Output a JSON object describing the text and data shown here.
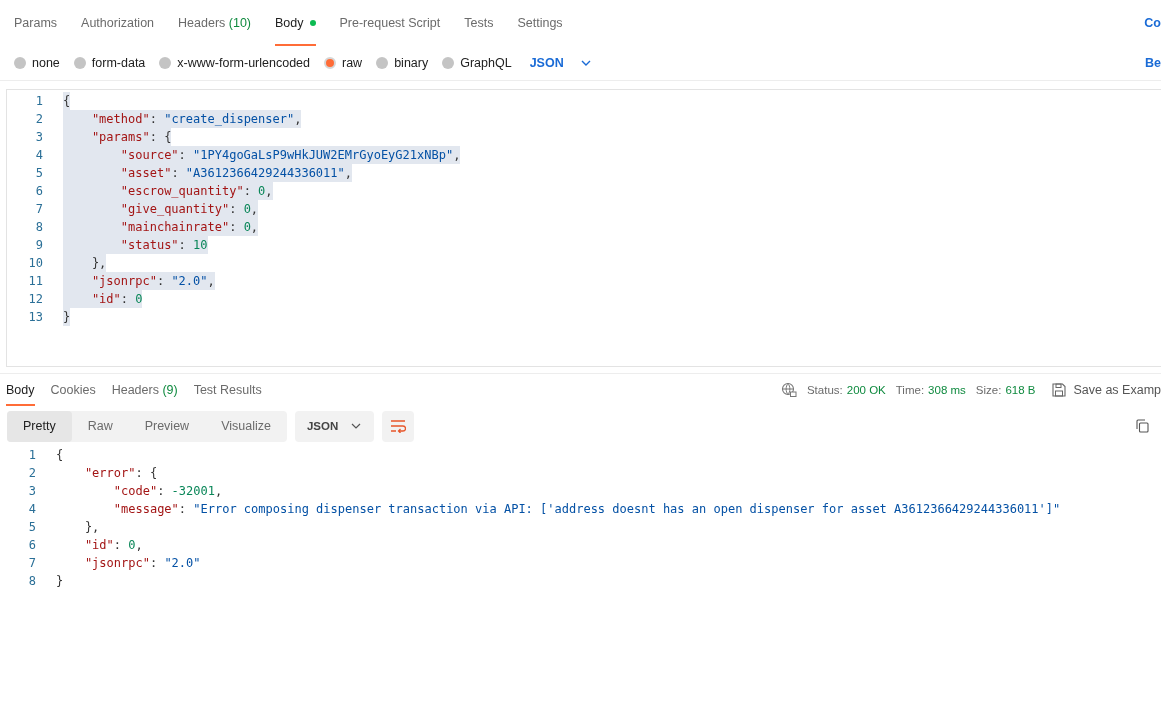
{
  "request_tabs": [
    {
      "label": "Params",
      "selected": false
    },
    {
      "label": "Authorization",
      "selected": false
    },
    {
      "label": "Headers",
      "count": "(10)",
      "selected": false
    },
    {
      "label": "Body",
      "dot": true,
      "selected": true
    },
    {
      "label": "Pre-request Script",
      "selected": false
    },
    {
      "label": "Tests",
      "selected": false
    },
    {
      "label": "Settings",
      "selected": false
    }
  ],
  "request_tabs_right_link": "Co",
  "body_types": [
    {
      "label": "none",
      "selected": false
    },
    {
      "label": "form-data",
      "selected": false
    },
    {
      "label": "x-www-form-urlencoded",
      "selected": false
    },
    {
      "label": "raw",
      "selected": true
    },
    {
      "label": "binary",
      "selected": false
    },
    {
      "label": "GraphQL",
      "selected": false
    }
  ],
  "body_format": "JSON",
  "beautify_link": "Be",
  "request_body": [
    {
      "number": "1",
      "selected": true,
      "tokens": [
        {
          "kind": "punct",
          "text": "{"
        }
      ]
    },
    {
      "number": "2",
      "selected": true,
      "tokens": [
        {
          "kind": "key",
          "text": "    \"method\""
        },
        {
          "kind": "punct",
          "text": ": "
        },
        {
          "kind": "str",
          "text": "\"create_dispenser\""
        },
        {
          "kind": "punct",
          "text": ","
        }
      ]
    },
    {
      "number": "3",
      "selected": true,
      "tokens": [
        {
          "kind": "key",
          "text": "    \"params\""
        },
        {
          "kind": "punct",
          "text": ": {"
        }
      ]
    },
    {
      "number": "4",
      "selected": true,
      "tokens": [
        {
          "kind": "key",
          "text": "        \"source\""
        },
        {
          "kind": "punct",
          "text": ": "
        },
        {
          "kind": "str",
          "text": "\"1PY4goGaLsP9wHkJUW2EMrGyoEyG21xNBp\""
        },
        {
          "kind": "punct",
          "text": ","
        }
      ]
    },
    {
      "number": "5",
      "selected": true,
      "tokens": [
        {
          "kind": "key",
          "text": "        \"asset\""
        },
        {
          "kind": "punct",
          "text": ": "
        },
        {
          "kind": "str",
          "text": "\"A3612366429244336011\""
        },
        {
          "kind": "punct",
          "text": ","
        }
      ]
    },
    {
      "number": "6",
      "selected": true,
      "tokens": [
        {
          "kind": "key",
          "text": "        \"escrow_quantity\""
        },
        {
          "kind": "punct",
          "text": ": "
        },
        {
          "kind": "num",
          "text": "0"
        },
        {
          "kind": "punct",
          "text": ","
        }
      ]
    },
    {
      "number": "7",
      "selected": true,
      "tokens": [
        {
          "kind": "key",
          "text": "        \"give_quantity\""
        },
        {
          "kind": "punct",
          "text": ": "
        },
        {
          "kind": "num",
          "text": "0"
        },
        {
          "kind": "punct",
          "text": ","
        }
      ]
    },
    {
      "number": "8",
      "selected": true,
      "tokens": [
        {
          "kind": "key",
          "text": "        \"mainchainrate\""
        },
        {
          "kind": "punct",
          "text": ": "
        },
        {
          "kind": "num",
          "text": "0"
        },
        {
          "kind": "punct",
          "text": ","
        }
      ]
    },
    {
      "number": "9",
      "selected": true,
      "tokens": [
        {
          "kind": "key",
          "text": "        \"status\""
        },
        {
          "kind": "punct",
          "text": ": "
        },
        {
          "kind": "num",
          "text": "10"
        }
      ]
    },
    {
      "number": "10",
      "selected": true,
      "tokens": [
        {
          "kind": "punct",
          "text": "    },"
        }
      ]
    },
    {
      "number": "11",
      "selected": true,
      "tokens": [
        {
          "kind": "key",
          "text": "    \"jsonrpc\""
        },
        {
          "kind": "punct",
          "text": ": "
        },
        {
          "kind": "str",
          "text": "\"2.0\""
        },
        {
          "kind": "punct",
          "text": ","
        }
      ]
    },
    {
      "number": "12",
      "selected": true,
      "tokens": [
        {
          "kind": "key",
          "text": "    \"id\""
        },
        {
          "kind": "punct",
          "text": ": "
        },
        {
          "kind": "num",
          "text": "0"
        }
      ]
    },
    {
      "number": "13",
      "selected": true,
      "tokens": [
        {
          "kind": "punct",
          "text": "}"
        }
      ]
    }
  ],
  "response_tabs": [
    {
      "label": "Body",
      "selected": true
    },
    {
      "label": "Cookies",
      "selected": false
    },
    {
      "label": "Headers",
      "count": "(9)",
      "selected": false
    },
    {
      "label": "Test Results",
      "selected": false
    }
  ],
  "status": {
    "status_label": "Status:",
    "status_value": "200 OK",
    "time_label": "Time:",
    "time_value": "308 ms",
    "size_label": "Size:",
    "size_value": "618 B",
    "save_label": "Save as Examp"
  },
  "view_modes": [
    {
      "label": "Pretty",
      "selected": true
    },
    {
      "label": "Raw",
      "selected": false
    },
    {
      "label": "Preview",
      "selected": false
    },
    {
      "label": "Visualize",
      "selected": false
    }
  ],
  "response_format": "JSON",
  "response_body": [
    {
      "number": "1",
      "tokens": [
        {
          "kind": "punct",
          "text": "{"
        }
      ]
    },
    {
      "number": "2",
      "tokens": [
        {
          "kind": "key",
          "text": "    \"error\""
        },
        {
          "kind": "punct",
          "text": ": {"
        }
      ]
    },
    {
      "number": "3",
      "tokens": [
        {
          "kind": "key",
          "text": "        \"code\""
        },
        {
          "kind": "punct",
          "text": ": "
        },
        {
          "kind": "num",
          "text": "-32001"
        },
        {
          "kind": "punct",
          "text": ","
        }
      ]
    },
    {
      "number": "4",
      "tokens": [
        {
          "kind": "key",
          "text": "        \"message\""
        },
        {
          "kind": "punct",
          "text": ": "
        },
        {
          "kind": "str",
          "text": "\"Error composing dispenser transaction via API: ['address doesnt has an open dispenser for asset A3612366429244336011']\""
        }
      ]
    },
    {
      "number": "5",
      "tokens": [
        {
          "kind": "punct",
          "text": "    },"
        }
      ]
    },
    {
      "number": "6",
      "tokens": [
        {
          "kind": "key",
          "text": "    \"id\""
        },
        {
          "kind": "punct",
          "text": ": "
        },
        {
          "kind": "num",
          "text": "0"
        },
        {
          "kind": "punct",
          "text": ","
        }
      ]
    },
    {
      "number": "7",
      "tokens": [
        {
          "kind": "key",
          "text": "    \"jsonrpc\""
        },
        {
          "kind": "punct",
          "text": ": "
        },
        {
          "kind": "str",
          "text": "\"2.0\""
        }
      ]
    },
    {
      "number": "8",
      "tokens": [
        {
          "kind": "punct",
          "text": "}"
        }
      ]
    }
  ]
}
